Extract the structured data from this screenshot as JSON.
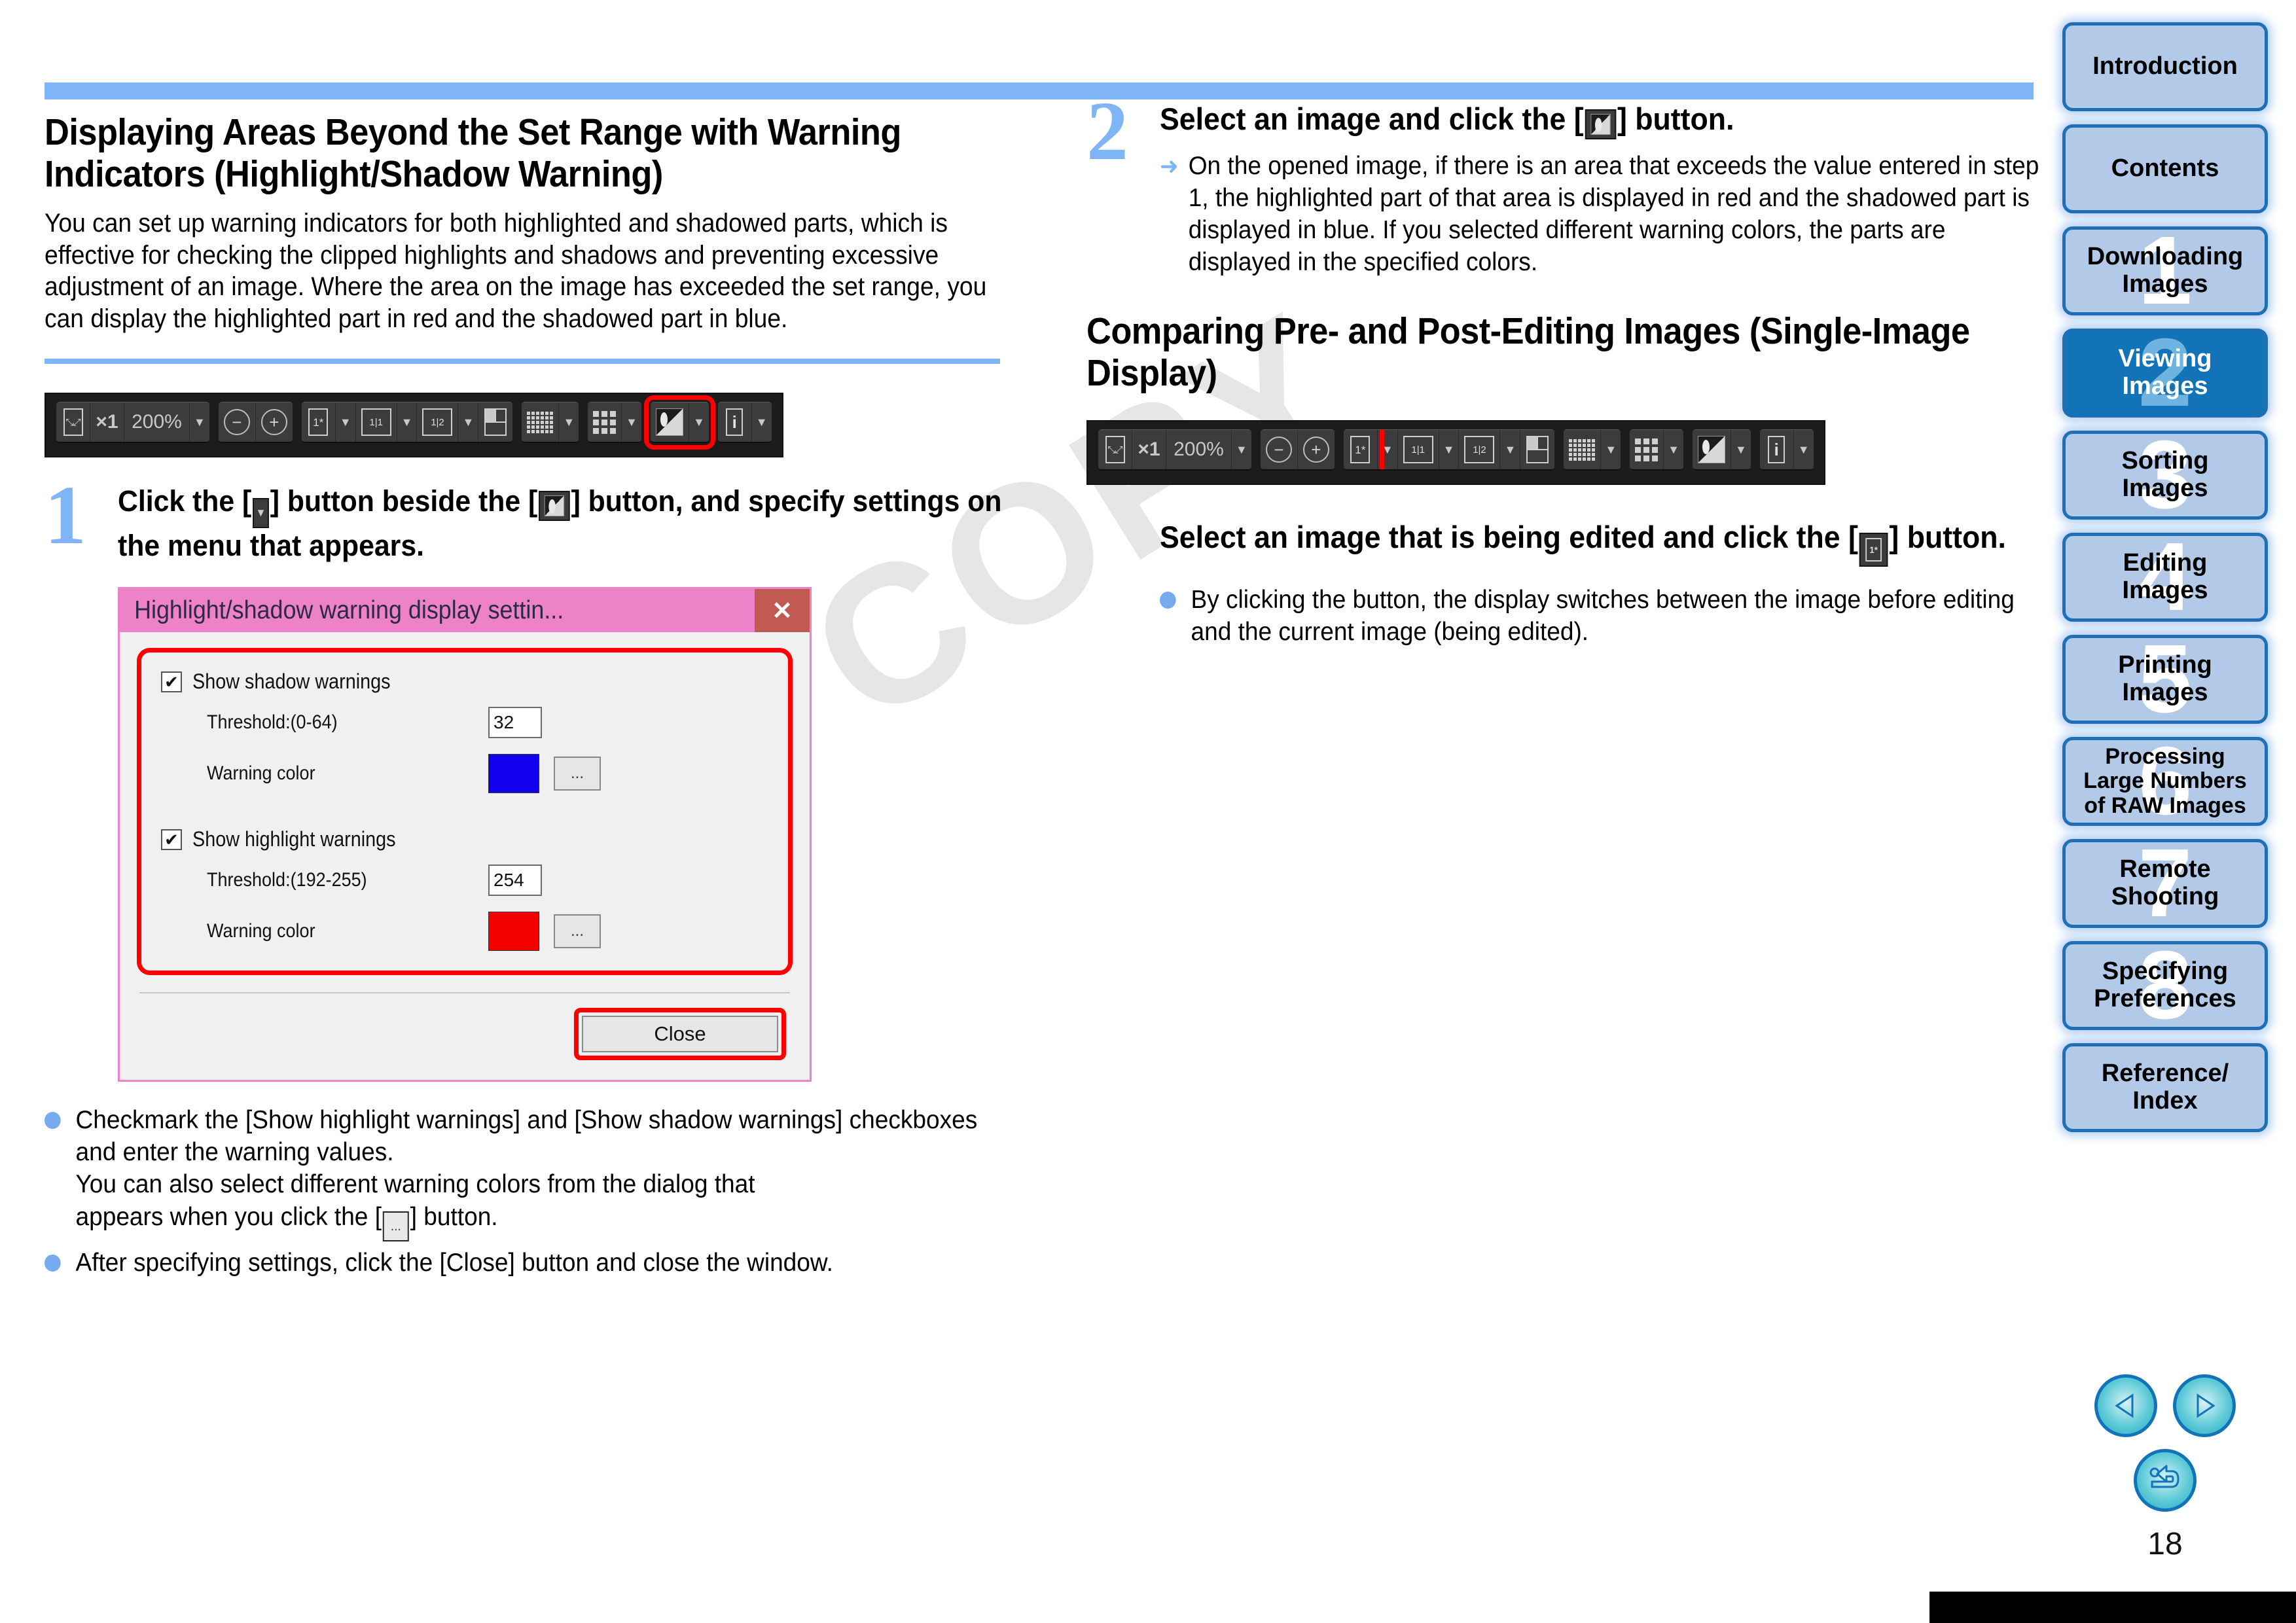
{
  "watermark": "COPY",
  "page_number": "18",
  "left_column": {
    "section_title": "Displaying Areas Beyond the Set Range with Warning Indicators (Highlight/Shadow Warning)",
    "intro_paragraph": "You can set up warning indicators for both highlighted and shadowed parts, which is effective for checking the clipped highlights and shadows and preventing excessive adjustment of an image. Where the area on the image has exceeded the set range, you can display the highlighted part in red and the shadowed part in blue.",
    "toolbar": {
      "fit_label": "fit-to-window-icon",
      "actual_size_label": "×1",
      "zoom_value": "200%",
      "zoom_out_label": "−",
      "zoom_in_label": "+",
      "before_after_label": "1*",
      "compare_label": "1 1",
      "two_up_label": "1 2",
      "split_label": "split-view-icon",
      "grid_label": "grid-icon",
      "thumb_label": "thumbnail-icon",
      "highlight_shadow_label": "highlight-shadow-icon",
      "info_label": "i",
      "highlighted_button": "highlight-shadow-warning-button"
    },
    "step1": {
      "number": "1",
      "heading_part1": "Click the [",
      "heading_part2": "] button beside the [",
      "heading_part3": "] button, and specify settings on the menu that appears."
    },
    "dialog": {
      "title": "Highlight/shadow warning display settin...",
      "close_x": "✕",
      "shadow": {
        "checkbox_label": "Show shadow warnings",
        "checked": "✔",
        "threshold_label": "Threshold:(0-64)",
        "threshold_value": "32",
        "color_label": "Warning color",
        "color_value": "#1100ee",
        "picker_label": "..."
      },
      "highlight": {
        "checkbox_label": "Show highlight warnings",
        "checked": "✔",
        "threshold_label": "Threshold:(192-255)",
        "threshold_value": "254",
        "color_label": "Warning color",
        "color_value": "#f50000",
        "picker_label": "..."
      },
      "close_button": "Close"
    },
    "bullets": [
      "Checkmark the [Show highlight warnings] and [Show shadow warnings] checkboxes and enter the warning values.",
      "You can also select different warning colors from the dialog that appears when you click the [ ] button.",
      "After specifying settings, click the [Close] button and close the window."
    ],
    "bullet_1_line2": "You can also select different warning colors from the dialog that",
    "bullet_1_line3a": "appears when you click the [",
    "bullet_1_line3b": "] button.",
    "bullet_2": "After specifying settings, click the [Close] button and close the window."
  },
  "right_column": {
    "step2": {
      "number": "2",
      "heading_part1": "Select an image and click the [",
      "heading_part2": "] button.",
      "arrow_text": "On the opened image, if there is an area that exceeds the value entered in step 1, the highlighted part of that area is displayed in red and the shadowed part is displayed in blue. If you selected different warning colors, the parts are displayed in the specified colors."
    },
    "section_title": "Comparing Pre- and Post-Editing Images (Single-Image Display)",
    "toolbar": {
      "zoom_value": "200%",
      "actual_size_label": "×1",
      "highlighted_button": "before-after-compare-button"
    },
    "subheading_part1": "Select an image that is being edited and click the [",
    "subheading_part2": "] button.",
    "bullet": "By clicking the button, the display switches between the image before editing and the current image (being edited)."
  },
  "sidebar": {
    "tabs": [
      {
        "label": "Introduction",
        "num": "",
        "active": false
      },
      {
        "label": "Contents",
        "num": "",
        "active": false
      },
      {
        "label": "Downloading\nImages",
        "num": "1",
        "active": false
      },
      {
        "label": "Viewing\nImages",
        "num": "2",
        "active": true
      },
      {
        "label": "Sorting\nImages",
        "num": "3",
        "active": false
      },
      {
        "label": "Editing\nImages",
        "num": "4",
        "active": false
      },
      {
        "label": "Printing\nImages",
        "num": "5",
        "active": false
      },
      {
        "label": "Processing\nLarge Numbers\nof RAW Images",
        "num": "6",
        "active": false
      },
      {
        "label": "Remote\nShooting",
        "num": "7",
        "active": false
      },
      {
        "label": "Specifying\nPreferences",
        "num": "8",
        "active": false
      },
      {
        "label": "Reference/\nIndex",
        "num": "",
        "active": false
      }
    ]
  },
  "nav": {
    "prev_label": "previous-page-button",
    "next_label": "next-page-button",
    "back_label": "back-button"
  },
  "colors": {
    "accent_blue": "#7fb4f7",
    "tab_blue": "#1273b8",
    "tab_fill": "#b3c9e8",
    "highlight_red": "#ff0000",
    "dialog_pink": "#ee82c8"
  }
}
